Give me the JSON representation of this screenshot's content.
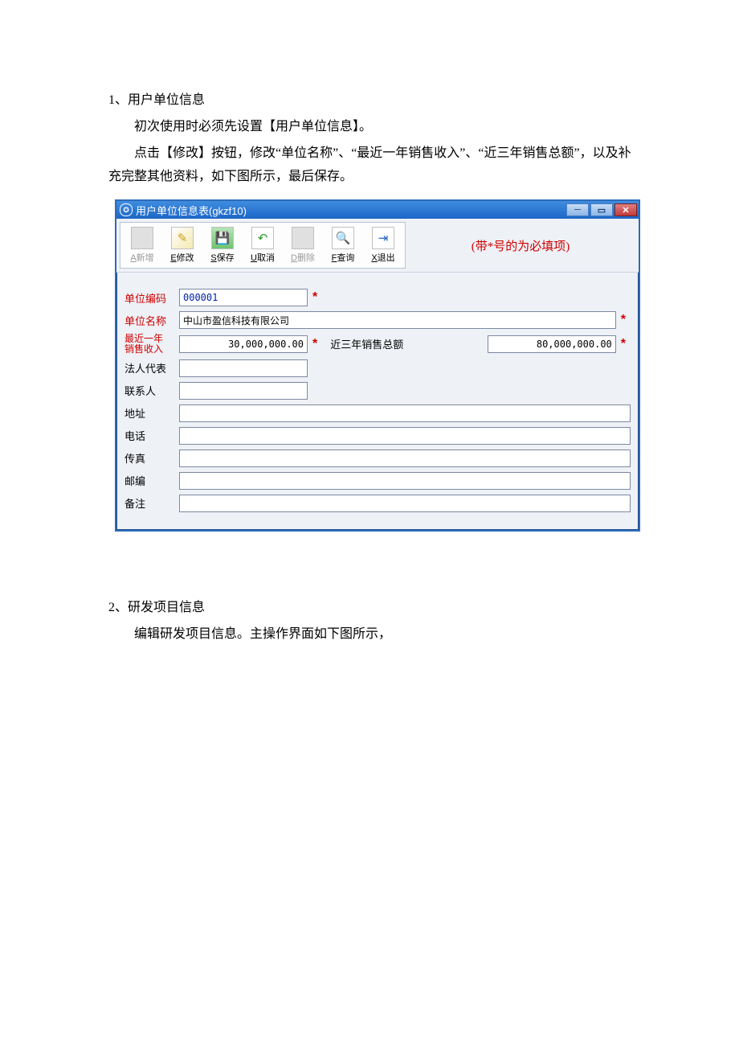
{
  "doc": {
    "s1_title": "1、用户单位信息",
    "s1_p1": "初次使用时必须先设置【用户单位信息】。",
    "s1_p2": "点击【修改】按钮，修改“单位名称”、“最近一年销售收入”、“近三年销售总额”，以及补充完整其他资料，如下图所示，最后保存。",
    "s2_title": "2、研发项目信息",
    "s2_p1": "编辑研发项目信息。主操作界面如下图所示，"
  },
  "window": {
    "title": "用户单位信息表(gkzf10)",
    "hint": "(带*号的为必填项)"
  },
  "toolbar": {
    "add": "A新增",
    "edit": "E修改",
    "save": "S保存",
    "undo": "U取消",
    "del": "D删除",
    "find": "F查询",
    "exit": "X退出"
  },
  "labels": {
    "code": "单位编码",
    "name": "单位名称",
    "rev1": "最近一年\n销售收入",
    "rev3": "近三年销售总额",
    "legal": "法人代表",
    "contact": "联系人",
    "addr": "地址",
    "tel": "电话",
    "fax": "传真",
    "zip": "邮编",
    "note": "备注"
  },
  "values": {
    "code": "000001",
    "name": "中山市盈信科技有限公司",
    "rev1": "30,000,000.00",
    "rev3": "80,000,000.00",
    "legal": "",
    "contact": "",
    "addr": "",
    "tel": "",
    "fax": "",
    "zip": "",
    "note": ""
  },
  "star": "*"
}
